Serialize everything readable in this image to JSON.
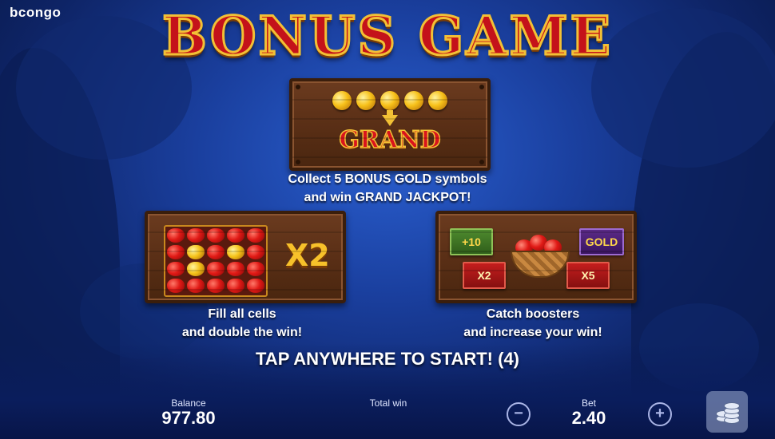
{
  "brand": {
    "logo_text": "bcongo"
  },
  "title": "BONUS GAME",
  "panels": {
    "grand": {
      "label": "GRAND",
      "coin_count": 5,
      "caption_line1": "Collect 5 BONUS GOLD symbols",
      "caption_line2": "and win GRAND JACKPOT!"
    },
    "fill": {
      "multiplier": "X2",
      "caption_line1": "Fill all cells",
      "caption_line2": "and double the win!"
    },
    "boosters": {
      "plus": "+10",
      "gold": "GOLD",
      "x2": "X2",
      "x5": "X5",
      "caption_line1": "Catch boosters",
      "caption_line2": "and increase your win!"
    }
  },
  "prompt": "TAP ANYWHERE TO START! (4)",
  "hud": {
    "balance_label": "Balance",
    "balance_value": "977.80",
    "total_win_label": "Total win",
    "bet_label": "Bet",
    "bet_value": "2.40",
    "minus_symbol": "−",
    "plus_symbol": "+"
  },
  "colors": {
    "title_red": "#c4121a",
    "gold": "#f2c035",
    "wood": "#5a2f16"
  },
  "icons": [
    "coin-icon",
    "down-arrow-icon",
    "apple-icon",
    "basket-icon",
    "minus-icon",
    "plus-icon",
    "chips-stack-icon"
  ]
}
